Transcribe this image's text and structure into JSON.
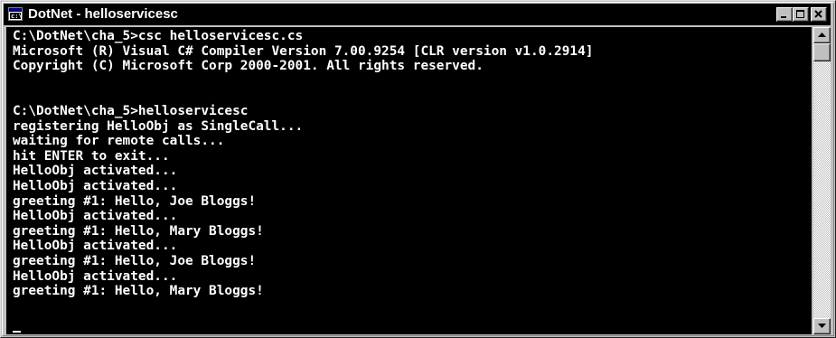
{
  "window": {
    "title": "DotNet - helloservicesc",
    "icon": "console-icon",
    "controls": [
      "minimize-icon",
      "maximize-icon",
      "close-icon"
    ]
  },
  "colors": {
    "titlebar": "#000000",
    "title_text": "#ffffff",
    "console_bg": "#000000",
    "console_text": "#ffffff",
    "chrome": "#c0c0c0"
  },
  "console": {
    "lines": [
      "C:\\DotNet\\cha_5>csc helloservicesc.cs",
      "Microsoft (R) Visual C# Compiler Version 7.00.9254 [CLR version v1.0.2914]",
      "Copyright (C) Microsoft Corp 2000-2001. All rights reserved.",
      "",
      "",
      "C:\\DotNet\\cha_5>helloservicesc",
      "registering HelloObj as SingleCall...",
      "waiting for remote calls...",
      "hit ENTER to exit...",
      "HelloObj activated...",
      "HelloObj activated...",
      "greeting #1: Hello, Joe Bloggs!",
      "HelloObj activated...",
      "greeting #1: Hello, Mary Bloggs!",
      "HelloObj activated...",
      "greeting #1: Hello, Joe Bloggs!",
      "HelloObj activated...",
      "greeting #1: Hello, Mary Bloggs!"
    ]
  },
  "scrollbar": {
    "up_icon": "arrow-up-icon",
    "down_icon": "arrow-down-icon",
    "position": 0
  }
}
